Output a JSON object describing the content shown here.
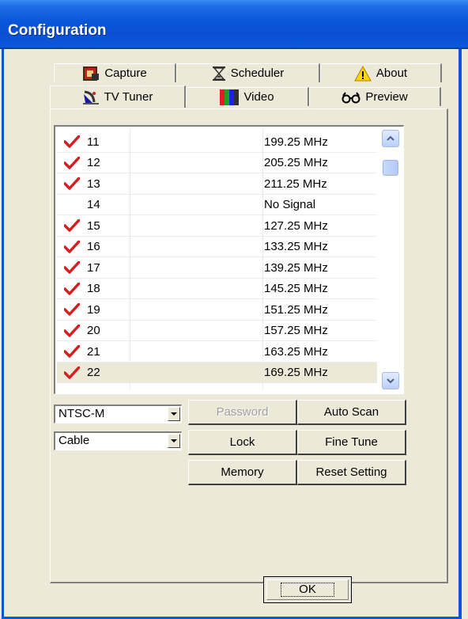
{
  "window": {
    "title": "Configuration"
  },
  "tabs_back": [
    {
      "label": "Capture",
      "icon": "capture-icon"
    },
    {
      "label": "Scheduler",
      "icon": "hourglass-icon"
    },
    {
      "label": "About",
      "icon": "warning-icon"
    }
  ],
  "tabs_front": [
    {
      "label": "TV Tuner",
      "icon": "satellite-icon",
      "active": true
    },
    {
      "label": "Video",
      "icon": "color-bars-icon"
    },
    {
      "label": "Preview",
      "icon": "glasses-icon"
    }
  ],
  "channels": [
    {
      "checked": true,
      "number": "11",
      "frequency": "199.25 MHz"
    },
    {
      "checked": true,
      "number": "12",
      "frequency": "205.25 MHz"
    },
    {
      "checked": true,
      "number": "13",
      "frequency": "211.25 MHz"
    },
    {
      "checked": false,
      "number": "14",
      "frequency": "No Signal"
    },
    {
      "checked": true,
      "number": "15",
      "frequency": "127.25 MHz"
    },
    {
      "checked": true,
      "number": "16",
      "frequency": "133.25 MHz"
    },
    {
      "checked": true,
      "number": "17",
      "frequency": "139.25 MHz"
    },
    {
      "checked": true,
      "number": "18",
      "frequency": "145.25 MHz"
    },
    {
      "checked": true,
      "number": "19",
      "frequency": "151.25 MHz"
    },
    {
      "checked": true,
      "number": "20",
      "frequency": "157.25 MHz"
    },
    {
      "checked": true,
      "number": "21",
      "frequency": "163.25 MHz"
    },
    {
      "checked": true,
      "number": "22",
      "frequency": "169.25 MHz",
      "selected": true
    }
  ],
  "standard_select": {
    "value": "NTSC-M"
  },
  "source_select": {
    "value": "Cable"
  },
  "buttons": {
    "password": "Password",
    "auto_scan": "Auto Scan",
    "lock": "Lock",
    "fine_tune": "Fine Tune",
    "memory": "Memory",
    "reset_setting": "Reset Setting",
    "ok": "OK"
  },
  "colors": {
    "titlebar": "#0a55d8",
    "check": "#d42020",
    "face": "#ece9d8"
  }
}
